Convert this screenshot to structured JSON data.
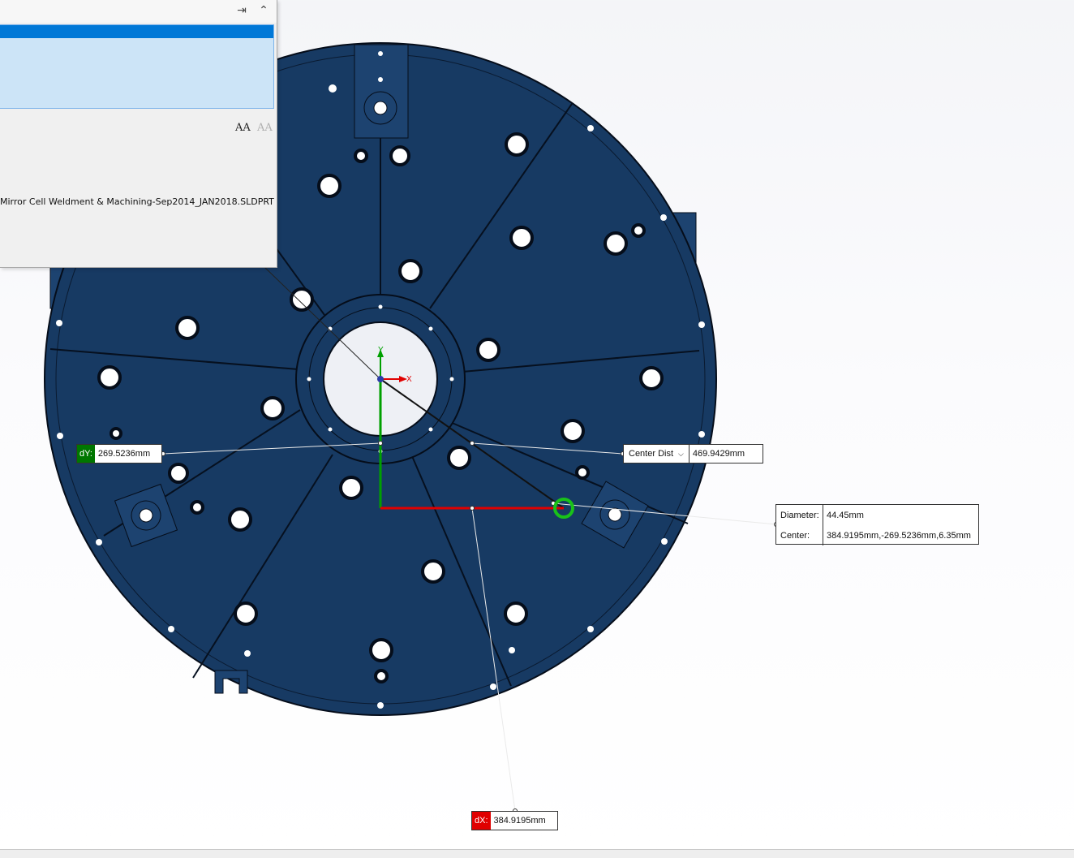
{
  "panel": {
    "pin_icon": "pin-icon",
    "collapse_icon": "chevron-up-icon",
    "font_increase_icon": "font-size-increase-icon",
    "font_decrease_icon": "font-size-decrease-icon",
    "font_increase_label": "AA",
    "font_decrease_label": "AA",
    "file_name": "Mirror Cell Weldment & Machining-Sep2014_JAN2018.SLDPRT"
  },
  "triad": {
    "x_label": "X",
    "y_label": "Y"
  },
  "measure": {
    "dy_label": "dY:",
    "dy_value": "269.5236mm",
    "dx_label": "dX:",
    "dx_value": "384.9195mm",
    "center_dist_label": "Center Dist",
    "center_dist_value": "469.9429mm",
    "diameter_label": "Diameter:",
    "diameter_value": "44.45mm",
    "center_label": "Center:",
    "center_value": "384.9195mm,-269.5236mm,6.35mm"
  },
  "colors": {
    "part_fill": "#173a63",
    "edge": "#050d1a",
    "x_axis": "#e00000",
    "y_axis": "#00a000",
    "selection_highlight": "#19c219"
  }
}
